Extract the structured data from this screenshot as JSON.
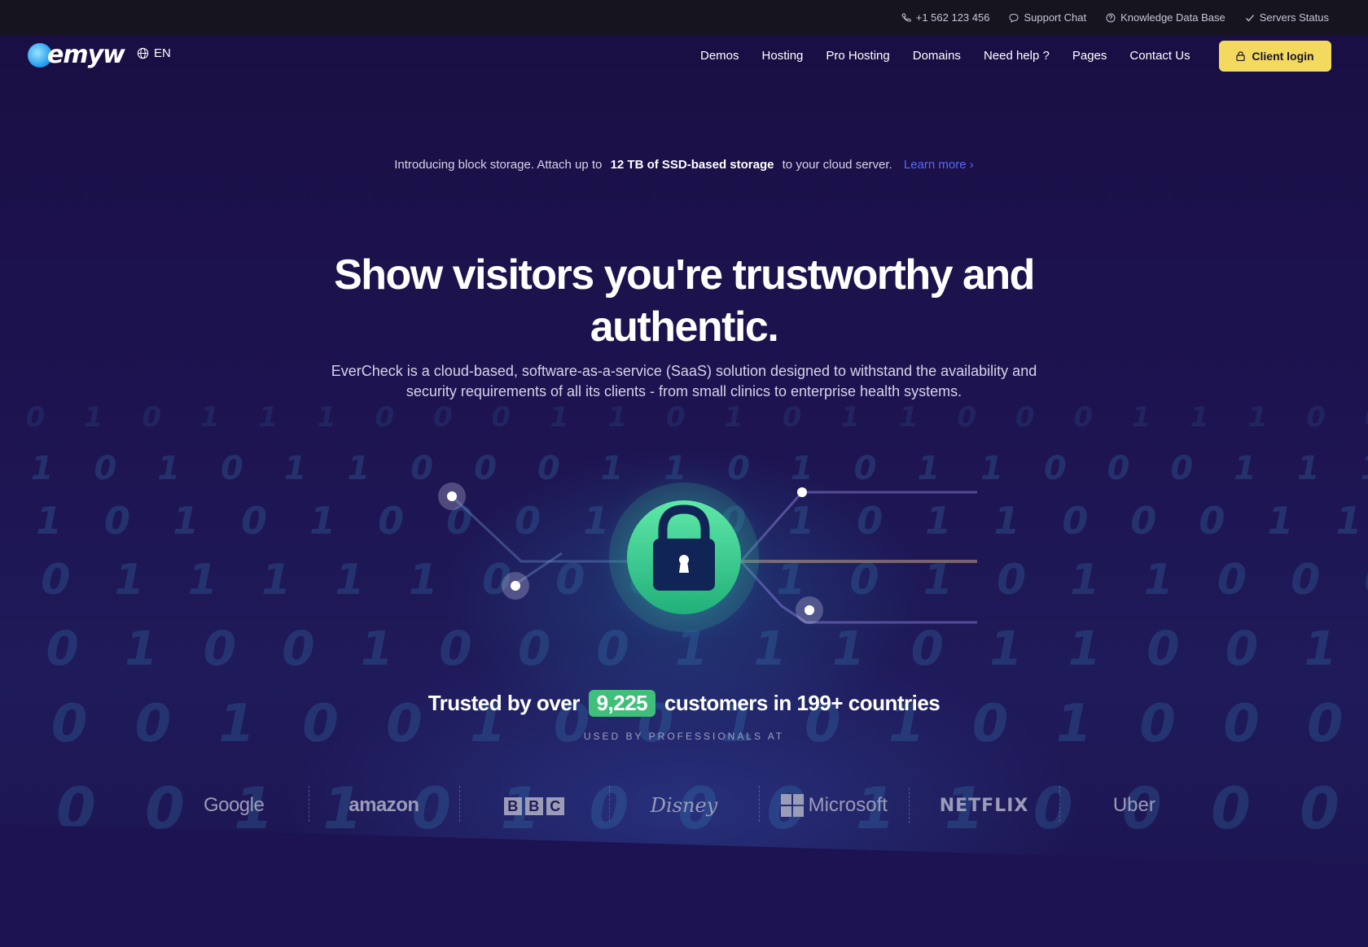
{
  "topbar": {
    "phone": "+1 562 123 456",
    "support": "Support Chat",
    "knowledge": "Knowledge Data Base",
    "status": "Servers Status"
  },
  "nav": {
    "logo_text": "emyw",
    "language": "EN",
    "items": [
      "Demos",
      "Hosting",
      "Pro Hosting",
      "Domains",
      "Need help ?",
      "Pages",
      "Contact Us"
    ],
    "login_label": "Client login"
  },
  "announce": {
    "prefix": "Introducing block storage. Attach up to",
    "bold": "12 TB of SSD-based storage",
    "suffix": "to your cloud server.",
    "link": "Learn more ›"
  },
  "hero": {
    "headline": "Show visitors you're trustworthy and authentic.",
    "subtitle": "EverCheck is a cloud-based, software-as-a-service (SaaS) solution designed to withstand the availability and security requirements of all its clients - from small clinics to enterprise health systems."
  },
  "trusted": {
    "prefix": "Trusted by over",
    "count": "9,225",
    "suffix": "customers in 199+ countries",
    "used_by": "USED BY PROFESSIONALS AT"
  },
  "brands": [
    "Google",
    "amazon",
    "BBC",
    "Disney",
    "Microsoft",
    "NETFLIX",
    "Uber"
  ],
  "colors": {
    "background": "#1b1045",
    "topbar": "#16141f",
    "accent_yellow": "#f3d95e",
    "accent_green": "#3fbf7a",
    "link_blue": "#5a6af0"
  }
}
